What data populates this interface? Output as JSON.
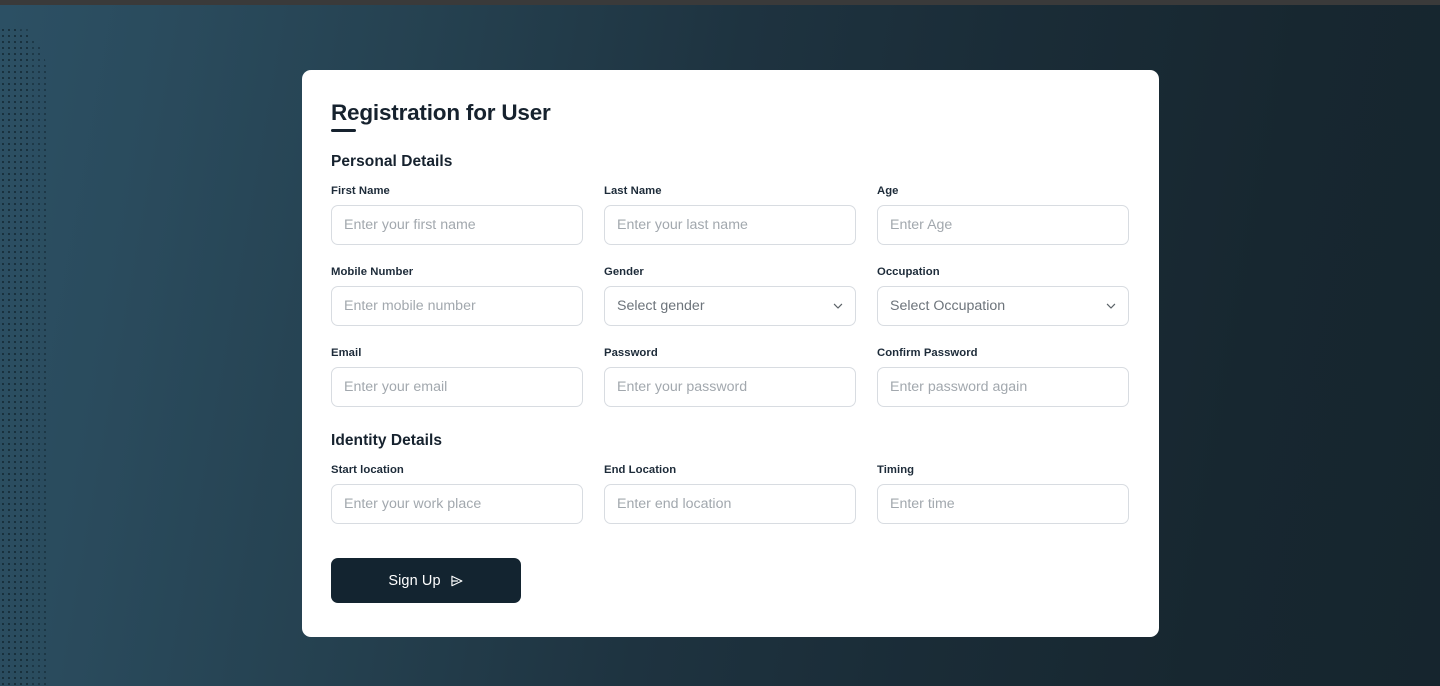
{
  "page": {
    "title": "Registration for User",
    "background_left_color": "#2c5064",
    "background_right_color": "#16252e",
    "card_background": "#ffffff"
  },
  "sections": [
    {
      "heading": "Personal Details",
      "rows": [
        [
          {
            "label": "First Name",
            "type": "input",
            "placeholder": "Enter your first name",
            "value": "",
            "name": "first-name"
          },
          {
            "label": "Last Name",
            "type": "input",
            "placeholder": "Enter your last name",
            "value": "",
            "name": "last-name"
          },
          {
            "label": "Age",
            "type": "input",
            "placeholder": "Enter Age",
            "value": "",
            "name": "age"
          }
        ],
        [
          {
            "label": "Mobile Number",
            "type": "input",
            "placeholder": "Enter mobile number",
            "value": "",
            "name": "mobile-number"
          },
          {
            "label": "Gender",
            "type": "select",
            "placeholder": "Select gender",
            "value": "Select gender",
            "name": "gender"
          },
          {
            "label": "Occupation",
            "type": "select",
            "placeholder": "Select Occupation",
            "value": "Select Occupation",
            "name": "occupation"
          }
        ],
        [
          {
            "label": "Email",
            "type": "input",
            "placeholder": "Enter your email",
            "value": "",
            "name": "email"
          },
          {
            "label": "Password",
            "type": "input",
            "placeholder": "Enter your password",
            "value": "",
            "name": "password"
          },
          {
            "label": "Confirm Password",
            "type": "input",
            "placeholder": "Enter password again",
            "value": "",
            "name": "confirm-password"
          }
        ]
      ]
    },
    {
      "heading": "Identity Details",
      "rows": [
        [
          {
            "label": "Start location",
            "type": "input",
            "placeholder": "Enter your work place",
            "value": "",
            "name": "start-location"
          },
          {
            "label": "End Location",
            "type": "input",
            "placeholder": "Enter end location",
            "value": "",
            "name": "end-location"
          },
          {
            "label": "Timing",
            "type": "input",
            "placeholder": "Enter time",
            "value": "",
            "name": "timing"
          }
        ]
      ]
    }
  ],
  "submit": {
    "label": "Sign Up",
    "icon": "send-icon",
    "background": "#132430",
    "text_color": "#ffffff"
  },
  "labels": {
    "personal_details": "Personal Details",
    "identity_details": "Identity Details",
    "first_name": "First Name",
    "last_name": "Last Name",
    "age": "Age",
    "mobile_number": "Mobile Number",
    "gender": "Gender",
    "occupation": "Occupation",
    "email": "Email",
    "password": "Password",
    "confirm_password": "Confirm Password",
    "start_location": "Start location",
    "end_location": "End Location",
    "timing": "Timing"
  },
  "placeholders": {
    "first_name": "Enter your first name",
    "last_name": "Enter your last name",
    "age": "Enter Age",
    "mobile_number": "Enter mobile number",
    "gender": "Select gender",
    "occupation": "Select Occupation",
    "email": "Enter your email",
    "password": "Enter your password",
    "confirm_password": "Enter password again",
    "start_location": "Enter your work place",
    "end_location": "Enter end location",
    "timing": "Enter time"
  }
}
